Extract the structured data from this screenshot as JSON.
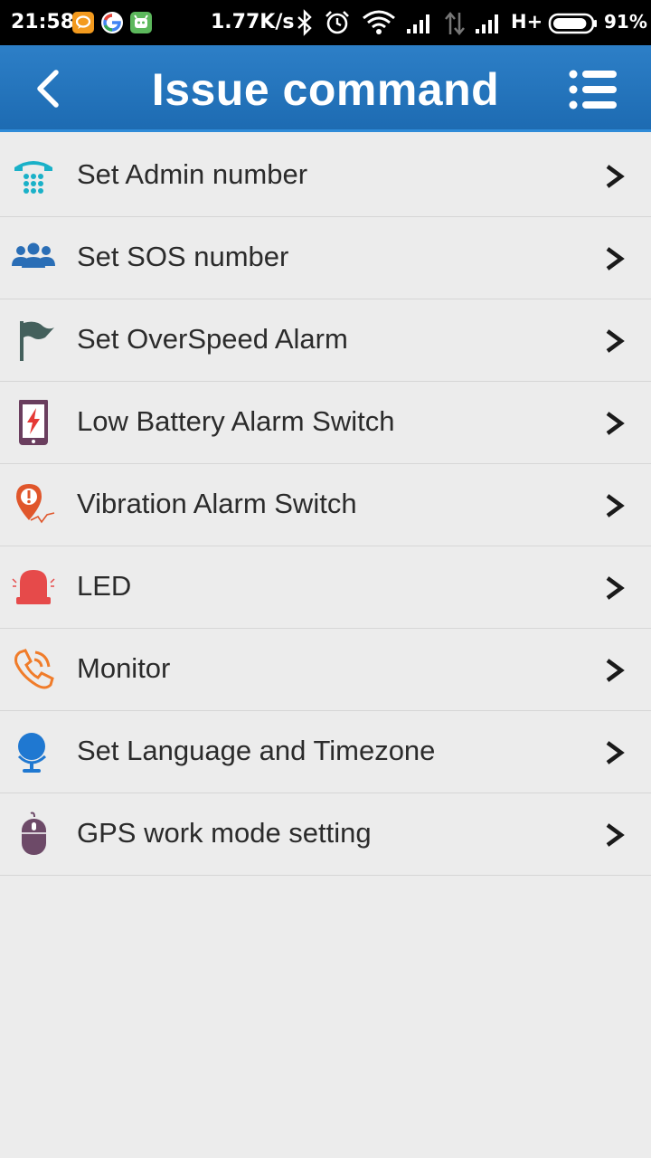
{
  "status_bar": {
    "time": "21:58",
    "net_speed": "1.77K/s",
    "network_type": "H+",
    "battery_percent": "91%",
    "battery_level": 0.91,
    "icons": [
      "chat-app-icon",
      "google-icon",
      "android-app-icon",
      "bluetooth-icon",
      "alarm-icon",
      "wifi-icon",
      "signal-icon",
      "data-arrows-icon",
      "signal-icon",
      "battery-icon"
    ]
  },
  "header": {
    "title": "Issue command",
    "back_icon": "chevron-left-icon",
    "menu_icon": "list-icon",
    "color": "#1f6fb6"
  },
  "items": [
    {
      "label": "Set Admin number",
      "icon": "telephone-icon",
      "color": "#1ab1c8"
    },
    {
      "label": "Set SOS number",
      "icon": "group-icon",
      "color": "#2a6eb6"
    },
    {
      "label": "Set OverSpeed Alarm",
      "icon": "flag-icon",
      "color": "#44605c"
    },
    {
      "label": "Low Battery Alarm Switch",
      "icon": "phone-charge-icon",
      "color": "#6a3e5e"
    },
    {
      "label": "Vibration Alarm Switch",
      "icon": "location-alert-icon",
      "color": "#e0562b"
    },
    {
      "label": "LED",
      "icon": "siren-icon",
      "color": "#e64a4a"
    },
    {
      "label": "Monitor",
      "icon": "phone-call-icon",
      "color": "#f07c2a"
    },
    {
      "label": "Set Language and Timezone",
      "icon": "globe-icon",
      "color": "#1f78d1"
    },
    {
      "label": "GPS work mode setting",
      "icon": "mouse-icon",
      "color": "#6d4a68"
    }
  ],
  "chevron_icon": "chevron-right-icon"
}
